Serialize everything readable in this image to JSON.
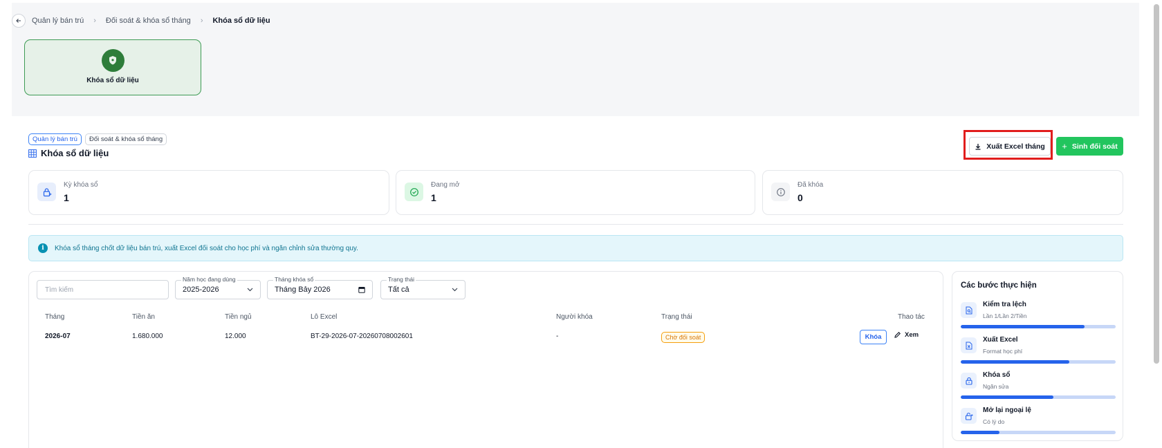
{
  "breadcrumb": {
    "items": [
      "Quản lý bán trú",
      "Đối soát & khóa sổ tháng"
    ],
    "current": "Khóa sổ dữ liệu"
  },
  "tile": {
    "label": "Khóa sổ dữ liệu"
  },
  "header": {
    "chips": [
      "Quản lý bán trú",
      "Đối soát & khóa sổ tháng"
    ],
    "title": "Khóa sổ dữ liệu",
    "export_label": "Xuất Excel tháng",
    "generate_label": "Sinh đối soát"
  },
  "stats": [
    {
      "label": "Kỳ khóa sổ",
      "value": "1",
      "color": "#2563eb"
    },
    {
      "label": "Đang mở",
      "value": "1",
      "color": "#16a34a"
    },
    {
      "label": "Đã khóa",
      "value": "0",
      "color": "#6b7280"
    }
  ],
  "info": {
    "text": "Khóa sổ tháng chốt dữ liệu bán trú, xuất Excel đối soát cho học phí và ngăn chỉnh sửa thường quy."
  },
  "filters": {
    "search_placeholder": "Tìm kiếm",
    "year_label": "Năm học đang dùng",
    "year_value": "2025-2026",
    "month_label": "Tháng khóa sổ",
    "month_value": "Tháng Bảy 2026",
    "status_label": "Trạng thái",
    "status_value": "Tất cả"
  },
  "table": {
    "columns": [
      "Tháng",
      "Tiền ăn",
      "Tiền ngủ",
      "Lô Excel",
      "Người khóa",
      "Trạng thái",
      "Thao tác"
    ],
    "rows": [
      {
        "month": "2026-07",
        "food": "1.680.000",
        "sleep": "12.000",
        "batch": "BT-29-2026-07-20260708002601",
        "locker": "-",
        "status": "Chờ đối soát",
        "lock_label": "Khóa",
        "view_label": "Xem"
      }
    ]
  },
  "steps": {
    "title": "Các bước thực hiện",
    "items": [
      {
        "title": "Kiểm tra lệch",
        "sub": "Lần 1/Lần 2/Tiền",
        "progress": 0.8
      },
      {
        "title": "Xuất Excel",
        "sub": "Format học phí",
        "progress": 0.7
      },
      {
        "title": "Khóa sổ",
        "sub": "Ngăn sửa",
        "progress": 0.6
      },
      {
        "title": "Mở lại ngoại lệ",
        "sub": "Có lý do",
        "progress": 0.25
      }
    ]
  },
  "colors": {
    "accent": "#2563eb",
    "success": "#22c55e",
    "brand_green": "#2e7d3a",
    "highlight": "#e11d1d"
  }
}
